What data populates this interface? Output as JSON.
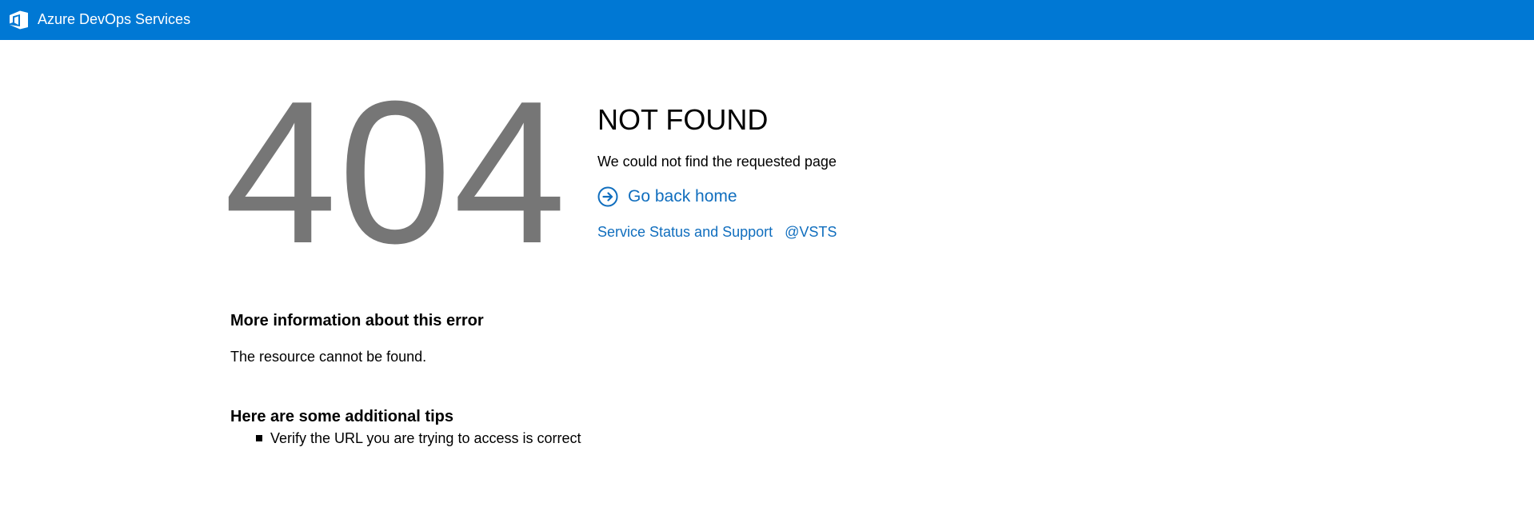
{
  "header": {
    "brand": "Azure DevOps Services",
    "logo_icon": "azure-devops-logo-icon",
    "bg_color": "#0078d4"
  },
  "error": {
    "code": "404",
    "title": "NOT FOUND",
    "subtitle": "We could not find the requested page",
    "home_link": "Go back home",
    "home_icon": "arrow-circle-right-icon",
    "links": [
      "Service Status and Support",
      "@VSTS"
    ],
    "code_color": "#767676",
    "link_color": "#106ebe"
  },
  "more_info": {
    "heading": "More information about this error",
    "text": "The resource cannot be found."
  },
  "tips": {
    "heading": "Here are some additional tips",
    "items": [
      "Verify the URL you are trying to access is correct"
    ]
  }
}
